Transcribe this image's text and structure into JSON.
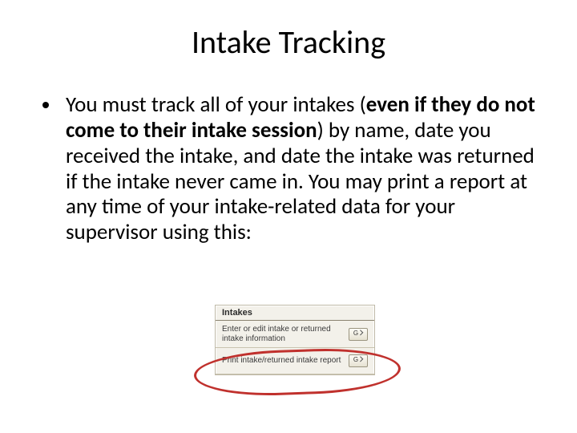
{
  "title": "Intake Tracking",
  "bullet": {
    "pre": "You must track all of your intakes (",
    "bold": "even if they do not come to their intake session",
    "post": ") by name, date you received the intake, and date the intake was returned if the intake never came in. You may print a report at any time of your intake-related data for your supervisor using this:"
  },
  "panel": {
    "header": "Intakes",
    "row1": {
      "label": "Enter or edit intake or returned intake information",
      "button": "G"
    },
    "row2": {
      "label": "Print intake/returned intake report",
      "button": "G"
    }
  }
}
